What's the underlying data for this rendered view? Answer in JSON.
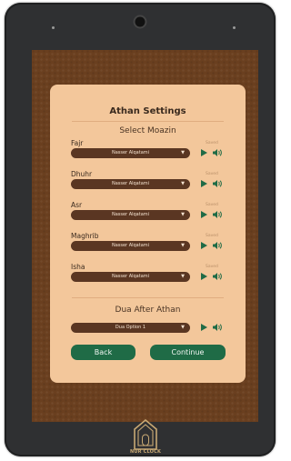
{
  "page": {
    "title": "Athan Settings",
    "subtitle_moazin": "Select Moazin",
    "subtitle_dua": "Dua After Athan"
  },
  "prayers": [
    {
      "name": "Fajr",
      "saved": "Saved",
      "moazin": "Nasser Alqatami"
    },
    {
      "name": "Dhuhr",
      "saved": "Saved",
      "moazin": "Nasser Alqatami"
    },
    {
      "name": "Asr",
      "saved": "Saved",
      "moazin": "Nasser Alqatami"
    },
    {
      "name": "Maghrib",
      "saved": "Saved",
      "moazin": "Nasser Alqatami"
    },
    {
      "name": "Isha",
      "saved": "Saved",
      "moazin": "Nasser Alqatami"
    }
  ],
  "dua": {
    "selected": "Dua Option 1"
  },
  "buttons": {
    "back": "Back",
    "continue": "Continue"
  },
  "brand": {
    "name": "NUR CLOCK"
  },
  "colors": {
    "card": "#f3c79b",
    "select_bg": "#5a3622",
    "accent_green": "#1f6b46",
    "frame": "#6a3f1f"
  }
}
